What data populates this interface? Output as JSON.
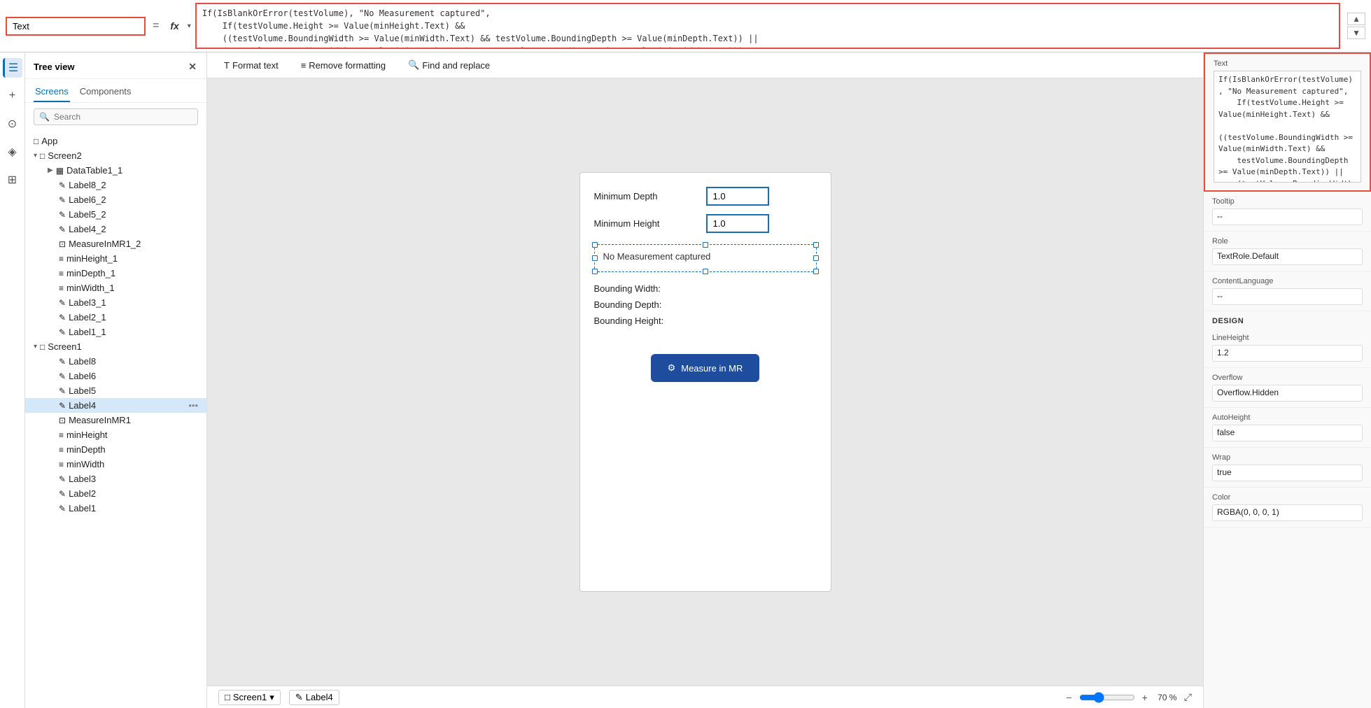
{
  "formulaBar": {
    "nameBox": "Text",
    "equals": "=",
    "fxLabel": "fx",
    "formula": "If(IsBlankOrError(testVolume), \"No Measurement captured\",\n    If(testVolume.Height >= Value(minHeight.Text) &&\n    ((testVolume.BoundingWidth >= Value(minWidth.Text) && testVolume.BoundingDepth >= Value(minDepth.Text)) ||\n    (testVolume.BoundingWidth >= Value(minDepth.Text) && testVolume.BoundingDepth >= Value(minWidth.Text))),\n    \"Fit Test Succeeded\", \"Fit Test Failed\"))"
  },
  "treeView": {
    "title": "Tree view",
    "tabs": [
      "Screens",
      "Components"
    ],
    "activeTab": "Screens",
    "search": {
      "placeholder": "Search"
    },
    "items": [
      {
        "id": "app",
        "label": "App",
        "icon": "□",
        "indent": 0,
        "type": "app"
      },
      {
        "id": "screen2",
        "label": "Screen2",
        "icon": "□",
        "indent": 0,
        "type": "screen",
        "expanded": true
      },
      {
        "id": "datatable1_1",
        "label": "DataTable1_1",
        "icon": "▦",
        "indent": 1,
        "type": "table"
      },
      {
        "id": "label8_2",
        "label": "Label8_2",
        "icon": "✎",
        "indent": 1,
        "type": "label"
      },
      {
        "id": "label6_2",
        "label": "Label6_2",
        "icon": "✎",
        "indent": 1,
        "type": "label"
      },
      {
        "id": "label5_2",
        "label": "Label5_2",
        "icon": "✎",
        "indent": 1,
        "type": "label"
      },
      {
        "id": "label4_2",
        "label": "Label4_2",
        "icon": "✎",
        "indent": 1,
        "type": "label"
      },
      {
        "id": "measureinmr1_2",
        "label": "MeasureInMR1_2",
        "icon": "⊡",
        "indent": 1,
        "type": "measure"
      },
      {
        "id": "minheight_1",
        "label": "minHeight_1",
        "icon": "≡",
        "indent": 1,
        "type": "input"
      },
      {
        "id": "mindepth_1",
        "label": "minDepth_1",
        "icon": "≡",
        "indent": 1,
        "type": "input"
      },
      {
        "id": "minwidth_1",
        "label": "minWidth_1",
        "icon": "≡",
        "indent": 1,
        "type": "input"
      },
      {
        "id": "label3_1",
        "label": "Label3_1",
        "icon": "✎",
        "indent": 1,
        "type": "label"
      },
      {
        "id": "label2_1",
        "label": "Label2_1",
        "icon": "✎",
        "indent": 1,
        "type": "label"
      },
      {
        "id": "label1_1",
        "label": "Label1_1",
        "icon": "✎",
        "indent": 1,
        "type": "label"
      },
      {
        "id": "screen1",
        "label": "Screen1",
        "icon": "□",
        "indent": 0,
        "type": "screen",
        "expanded": true
      },
      {
        "id": "label8",
        "label": "Label8",
        "icon": "✎",
        "indent": 1,
        "type": "label"
      },
      {
        "id": "label6",
        "label": "Label6",
        "icon": "✎",
        "indent": 1,
        "type": "label"
      },
      {
        "id": "label5",
        "label": "Label5",
        "icon": "✎",
        "indent": 1,
        "type": "label"
      },
      {
        "id": "label4",
        "label": "Label4",
        "icon": "✎",
        "indent": 1,
        "type": "label",
        "selected": true
      },
      {
        "id": "measureinmr1",
        "label": "MeasureInMR1",
        "icon": "⊡",
        "indent": 1,
        "type": "measure"
      },
      {
        "id": "minheight",
        "label": "minHeight",
        "icon": "≡",
        "indent": 1,
        "type": "input"
      },
      {
        "id": "mindepth",
        "label": "minDepth",
        "icon": "≡",
        "indent": 1,
        "type": "input"
      },
      {
        "id": "minwidth",
        "label": "minWidth",
        "icon": "≡",
        "indent": 1,
        "type": "input"
      },
      {
        "id": "label3",
        "label": "Label3",
        "icon": "✎",
        "indent": 1,
        "type": "label"
      },
      {
        "id": "label2",
        "label": "Label2",
        "icon": "✎",
        "indent": 1,
        "type": "label"
      },
      {
        "id": "label1",
        "label": "Label1",
        "icon": "✎",
        "indent": 1,
        "type": "label"
      }
    ]
  },
  "toolbar": {
    "formatText": "Format text",
    "removeFormatting": "Remove formatting",
    "findAndReplace": "Find and replace"
  },
  "canvas": {
    "formRows": [
      {
        "label": "Minimum Depth",
        "value": "1.0"
      },
      {
        "label": "Minimum Height",
        "value": "1.0"
      }
    ],
    "labelText": "No Measurement captured",
    "boundingRows": [
      "Bounding Width:",
      "Bounding Depth:",
      "Bounding Height:"
    ],
    "measureButton": "Measure in MR"
  },
  "rightPanel": {
    "textLabel": "Text",
    "textValue": "If(IsBlankOrError(testVolume), \"No Measurement captured\",\n    If(testVolume.Height >= Value(minHeight.Text) &&\n    ((testVolume.BoundingWidth >= Value(minWidth.Text) &&\n    testVolume.BoundingDepth >= Value(minDepth.Text)) ||\n    (testVolume.BoundingWidth >= Value(minDepth.Text) &&\n    testVolume.BoundingDepth >= Value(minWidth.Text)...",
    "tooltipLabel": "Tooltip",
    "tooltipValue": "--",
    "roleLabel": "Role",
    "roleValue": "TextRole.Default",
    "contentLanguageLabel": "ContentLanguage",
    "contentLanguageValue": "--",
    "designHeading": "DESIGN",
    "lineHeightLabel": "LineHeight",
    "lineHeightValue": "1.2",
    "overflowLabel": "Overflow",
    "overflowValue": "Overflow.Hidden",
    "autoHeightLabel": "AutoHeight",
    "autoHeightValue": "false",
    "wrapLabel": "Wrap",
    "wrapValue": "true",
    "colorLabel": "Color",
    "colorValue": "RGBA(0, 0, 0, 1)"
  },
  "statusBar": {
    "screenLabel": "Screen1",
    "labelLabel": "Label4",
    "zoomValue": "70 %",
    "zoomPercent": 70
  }
}
